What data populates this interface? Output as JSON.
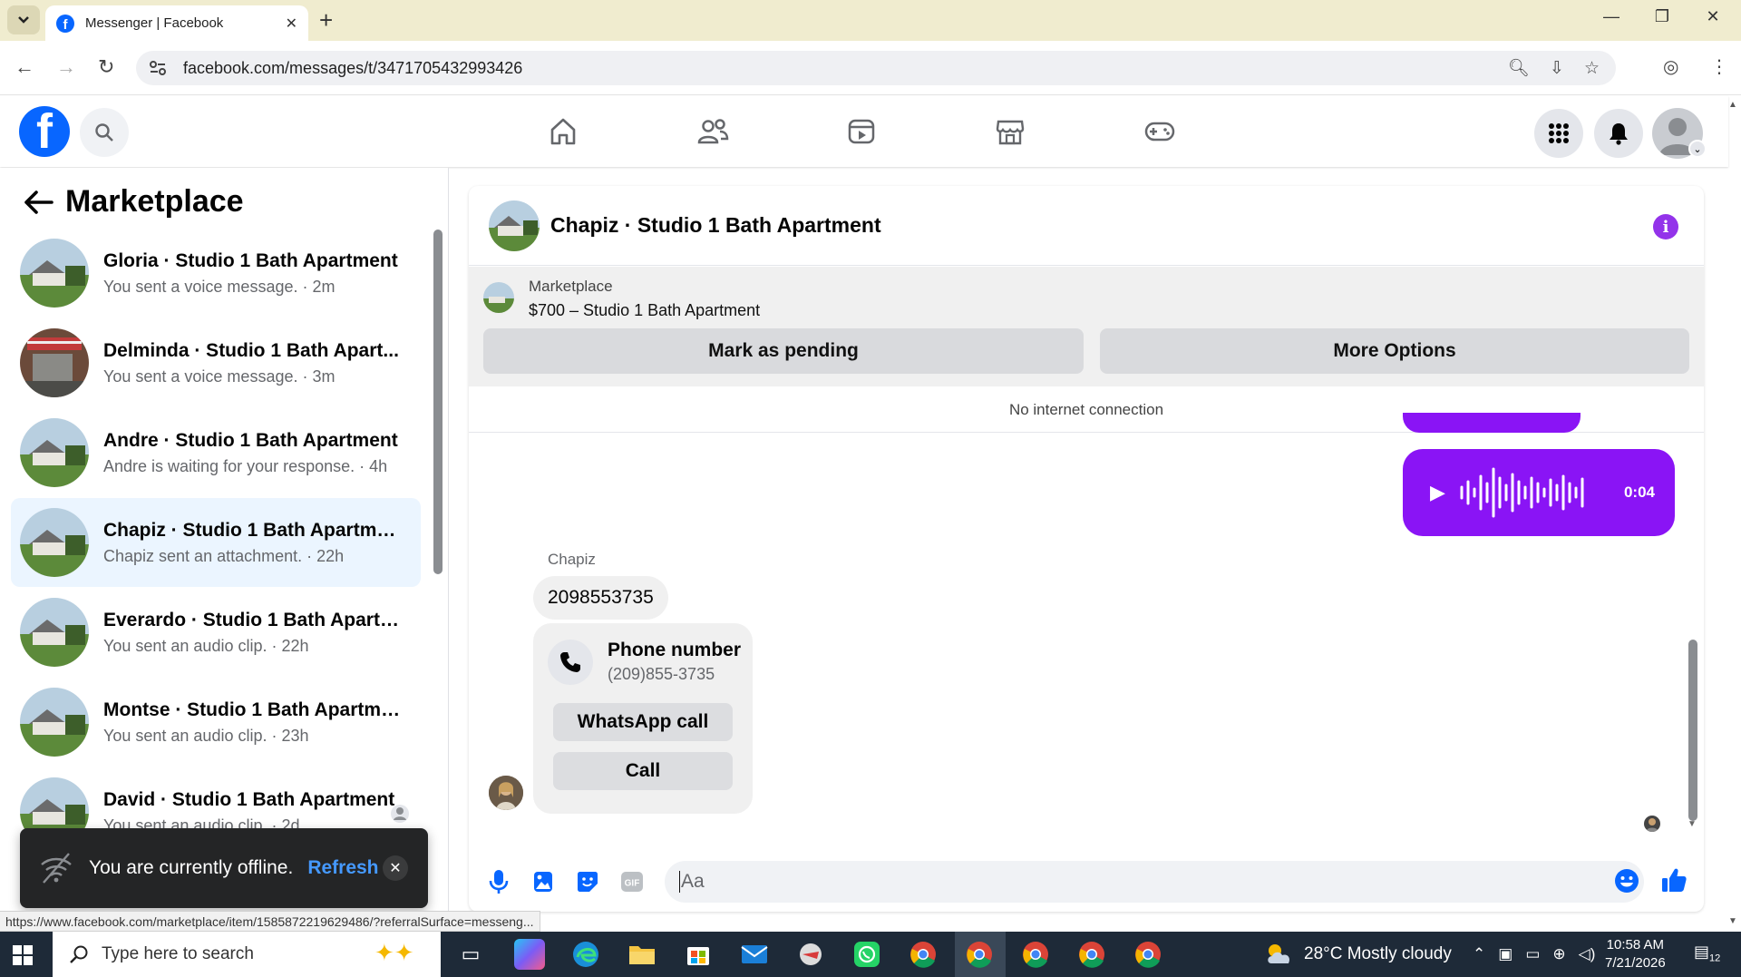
{
  "browser": {
    "tab_title": "Messenger | Facebook",
    "url": "facebook.com/messages/t/3471705432993426",
    "status_url": "https://www.facebook.com/marketplace/item/1585872219629486/?referralSurface=messeng..."
  },
  "sidebar": {
    "title": "Marketplace",
    "conversations": [
      {
        "name": "Gloria · Studio 1 Bath Apartment",
        "sub": "You sent a voice message. · 2m"
      },
      {
        "name": "Delminda · Studio 1 Bath Apart...",
        "sub": "You sent a voice message. · 3m"
      },
      {
        "name": "Andre · Studio 1 Bath Apartment",
        "sub": "Andre is waiting for your response. · 4h"
      },
      {
        "name": "Chapiz · Studio 1 Bath Apartment",
        "sub": "Chapiz sent an attachment. · 22h"
      },
      {
        "name": "Everardo · Studio 1 Bath Apartm...",
        "sub": "You sent an audio clip. · 22h"
      },
      {
        "name": "Montse · Studio 1 Bath Apartment",
        "sub": "You sent an audio clip. · 23h"
      },
      {
        "name": "David · Studio 1 Bath Apartment",
        "sub": "You sent an audio clip. · 2d"
      }
    ]
  },
  "chat": {
    "title": "Chapiz · Studio 1 Bath Apartment",
    "listing_category": "Marketplace",
    "listing_price": "$700 – Studio 1 Bath Apartment",
    "mark_pending": "Mark as pending",
    "more_options": "More Options",
    "connection_status": "No internet connection",
    "voice_duration": "0:04",
    "sender_name": "Chapiz",
    "phone_message": "2098553735",
    "card_title": "Phone number",
    "card_number": "(209)855-3735",
    "whatsapp_call": "WhatsApp call",
    "call": "Call",
    "composer_placeholder": "Aa"
  },
  "toast": {
    "message": "You are currently offline.",
    "refresh": "Refresh"
  },
  "taskbar": {
    "search_placeholder": "Type here to search",
    "weather": "28°C  Mostly cloudy",
    "time": "10:58 AM",
    "date": "7/21/2026",
    "notification_count": "12"
  },
  "colors": {
    "facebook_blue": "#0866ff",
    "messenger_purple": "#8a14f5",
    "active_conversation": "#ebf5ff"
  }
}
